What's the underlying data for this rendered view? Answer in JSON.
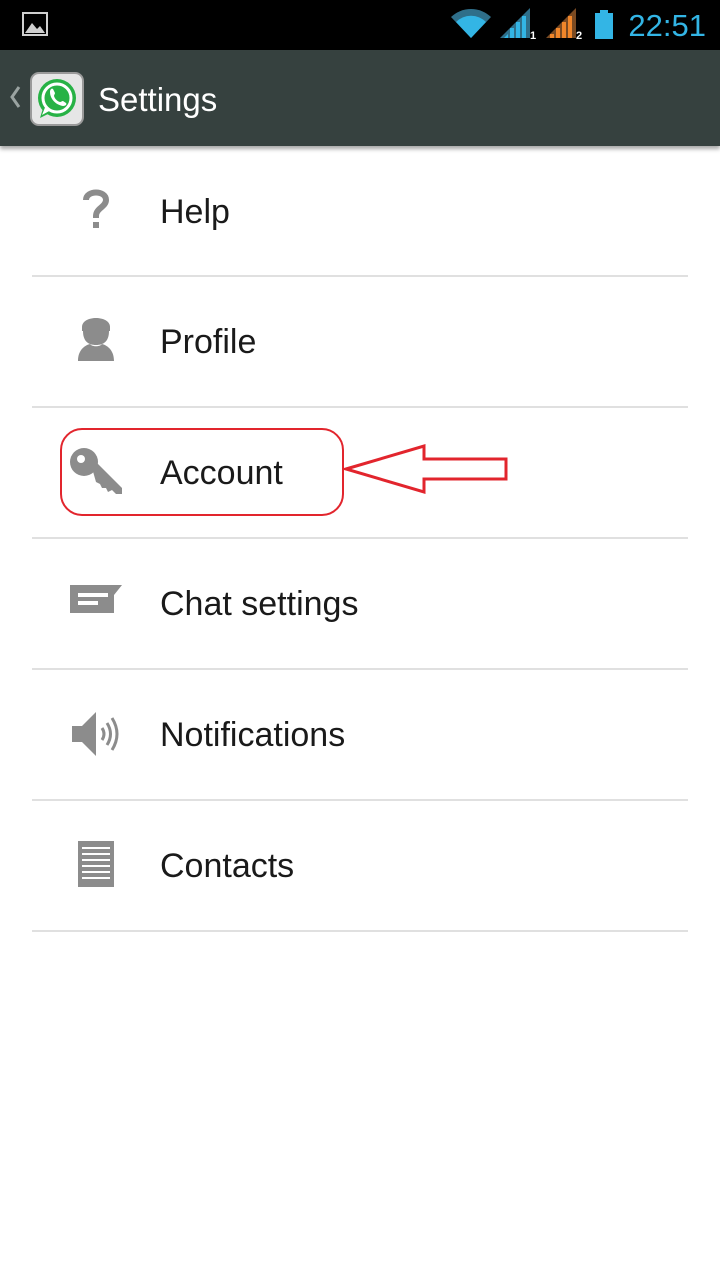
{
  "status_bar": {
    "time": "22:51",
    "icons": [
      "gallery-icon",
      "wifi-icon",
      "signal-sim1-icon",
      "signal-sim2-icon",
      "battery-icon"
    ],
    "colors": {
      "time": "#33b5e5",
      "signal_sim1": "#33b5e5",
      "signal_sim2": "#f0862a"
    }
  },
  "action_bar": {
    "title": "Settings",
    "icons": [
      "back-chevron-icon",
      "whatsapp-logo-icon"
    ],
    "background": "#36413f"
  },
  "settings_list": {
    "items": [
      {
        "label": "Help",
        "icon": "help-icon"
      },
      {
        "label": "Profile",
        "icon": "profile-icon"
      },
      {
        "label": "Account",
        "icon": "key-icon"
      },
      {
        "label": "Chat settings",
        "icon": "chat-icon"
      },
      {
        "label": "Notifications",
        "icon": "speaker-icon"
      },
      {
        "label": "Contacts",
        "icon": "contacts-list-icon"
      }
    ]
  },
  "annotation": {
    "highlighted_item": "Account",
    "color": "#e2252d"
  }
}
